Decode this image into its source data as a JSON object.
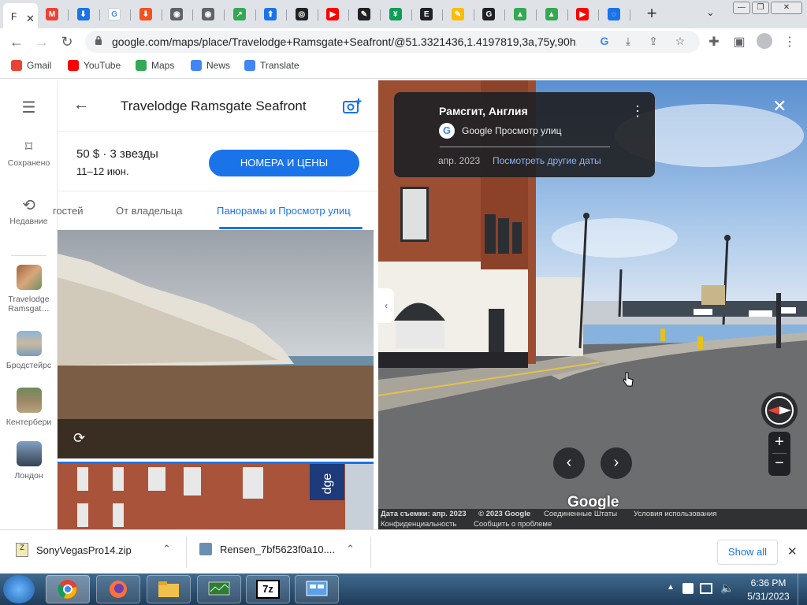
{
  "browser": {
    "active_tab_letter": "F",
    "tab_close": "✕",
    "new_tab": "+",
    "tab_list": "⌄",
    "tab_favicons": [
      {
        "icon": "gmail-icon",
        "color": "#ea4335",
        "letter": "M"
      },
      {
        "icon": "download-icon",
        "color": "#1a73e8",
        "letter": "⬇"
      },
      {
        "icon": "google-icon",
        "color": "#ffffff",
        "letter": "G"
      },
      {
        "icon": "download-orange-icon",
        "color": "#f4511e",
        "letter": "⬇"
      },
      {
        "icon": "globe-icon",
        "color": "#5f6368",
        "letter": "◉"
      },
      {
        "icon": "globe-icon",
        "color": "#5f6368",
        "letter": "◉"
      },
      {
        "icon": "share-icon",
        "color": "#34a853",
        "letter": "↗"
      },
      {
        "icon": "upload-icon",
        "color": "#1a73e8",
        "letter": "⬆"
      },
      {
        "icon": "github-icon",
        "color": "#202124",
        "letter": "◎"
      },
      {
        "icon": "youtube-icon",
        "color": "#ff0000",
        "letter": "▶"
      },
      {
        "icon": "tools-icon",
        "color": "#202124",
        "letter": "✎"
      },
      {
        "icon": "sheets-icon",
        "color": "#0f9d58",
        "letter": "¥"
      },
      {
        "icon": "e-icon",
        "color": "#202124",
        "letter": "E"
      },
      {
        "icon": "pencil-icon",
        "color": "#fbbc04",
        "letter": "✎"
      },
      {
        "icon": "g-yellow-icon",
        "color": "#202124",
        "letter": "G"
      },
      {
        "icon": "drive-icon",
        "color": "#34a853",
        "letter": "▲"
      },
      {
        "icon": "drive-icon",
        "color": "#34a853",
        "letter": "▲"
      },
      {
        "icon": "youtube-icon",
        "color": "#ff0000",
        "letter": "▶"
      },
      {
        "icon": "loading-icon",
        "color": "#1a73e8",
        "letter": "◌"
      }
    ],
    "window_controls": {
      "minimize": "—",
      "restore": "❐",
      "close": "✕"
    },
    "url": "google.com/maps/place/Travelodge+Ramsgate+Seafront/@51.3321436,1.4197819,3a,75y,90h,90...",
    "bookmarks": [
      {
        "label": "Gmail",
        "icon": "gmail-icon",
        "color": "#ea4335"
      },
      {
        "label": "YouTube",
        "icon": "youtube-icon",
        "color": "#ff0000"
      },
      {
        "label": "Maps",
        "icon": "maps-pin-icon",
        "color": "#34a853"
      },
      {
        "label": "News",
        "icon": "news-icon",
        "color": "#4285f4"
      },
      {
        "label": "Translate",
        "icon": "translate-icon",
        "color": "#4285f4"
      }
    ]
  },
  "maps": {
    "rail": {
      "saved": "Сохранено",
      "recent": "Недавние",
      "places": [
        "Travelodge Ramsgat…",
        "Бродстейрс",
        "Кентербери",
        "Лондон"
      ]
    },
    "panel": {
      "title": "Travelodge Ramsgate Seafront",
      "price": "50 $ · 3 звезды",
      "dates": "11–12 июн.",
      "book_button": "НОМЕРА И ЦЕНЫ",
      "tabs": [
        "гостей",
        "От владельца",
        "Панорамы и Просмотр улиц"
      ]
    },
    "streetview": {
      "place": "Рамсгит, Англия",
      "source": "Google Просмотр улиц",
      "date": "апр. 2023",
      "other_dates": "Посмотреть другие даты",
      "watermark": "Google",
      "zoom_in": "+",
      "zoom_out": "−",
      "footer_line1": [
        "Дата съемки: апр. 2023",
        "© 2023 Google",
        "Соединенные Штаты",
        "Условия использования"
      ],
      "footer_line2": [
        "Конфиденциальность",
        "Сообщить о проблеме"
      ]
    }
  },
  "downloads": {
    "items": [
      "SonyVegasPro14.zip",
      "Rensen_7bf5623f0a10...."
    ],
    "show_all": "Show all",
    "close": "✕"
  },
  "taskbar": {
    "time": "6:36 PM",
    "date": "5/31/2023"
  }
}
